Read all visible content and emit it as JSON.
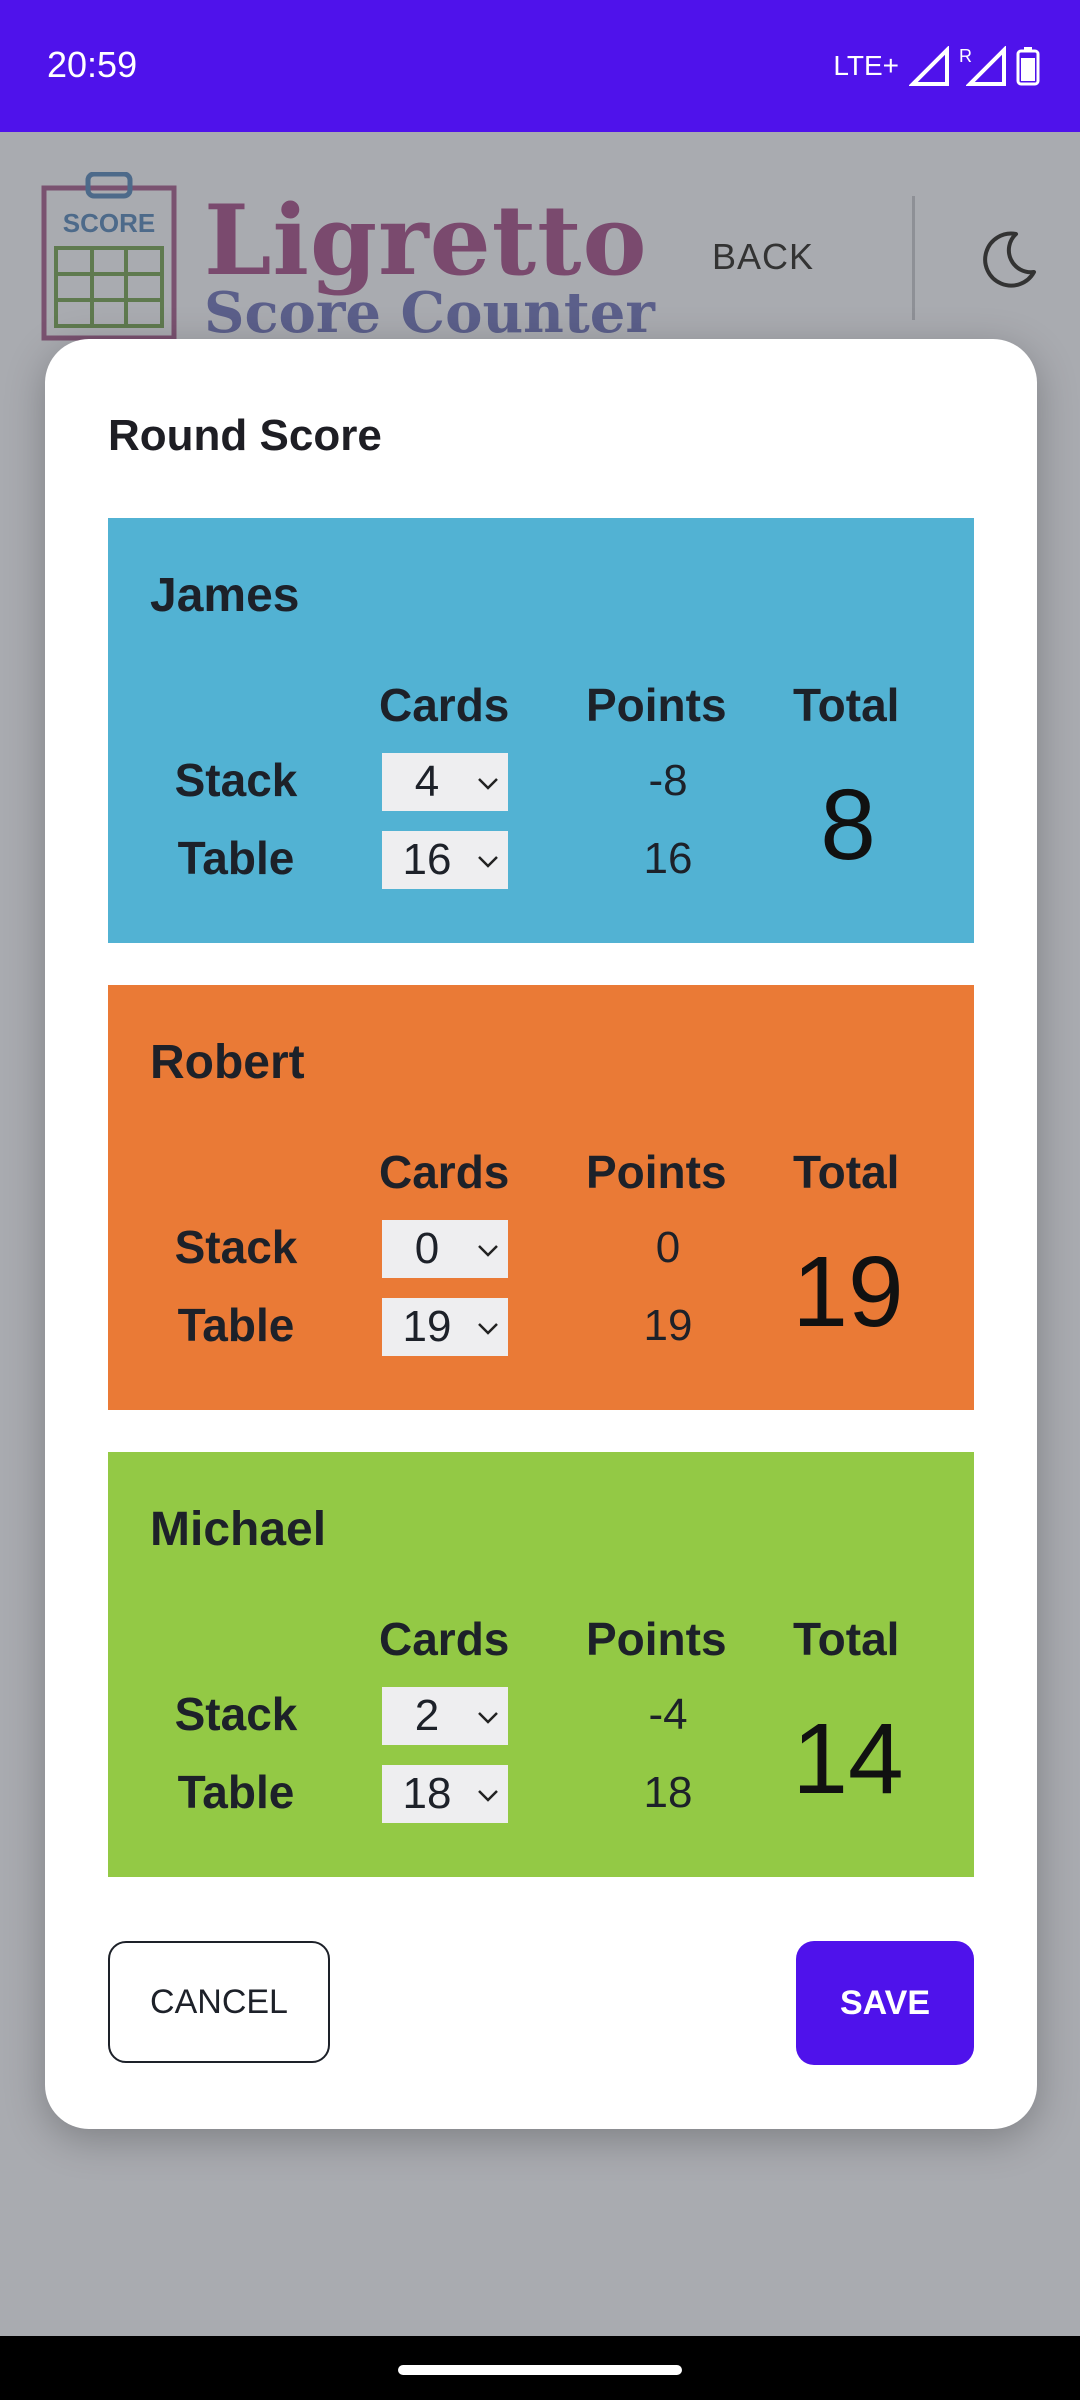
{
  "status_bar": {
    "time": "20:59",
    "network": "LTE+",
    "roaming": "R"
  },
  "header": {
    "logo_badge": "SCORE",
    "logo_title": "Ligretto",
    "logo_subtitle": "Score Counter",
    "back_label": "BACK"
  },
  "dialog": {
    "title": "Round Score",
    "column_headers": {
      "cards": "Cards",
      "points": "Points",
      "total": "Total"
    },
    "row_labels": {
      "stack": "Stack",
      "table": "Table"
    },
    "players": [
      {
        "name": "James",
        "color": "#52b2d3",
        "stack_cards": "4",
        "table_cards": "16",
        "stack_points": "-8",
        "table_points": "16",
        "total": "8"
      },
      {
        "name": "Robert",
        "color": "#ea7a36",
        "stack_cards": "0",
        "table_cards": "19",
        "stack_points": "0",
        "table_points": "19",
        "total": "19"
      },
      {
        "name": "Michael",
        "color": "#93c945",
        "stack_cards": "2",
        "table_cards": "18",
        "stack_points": "-4",
        "table_points": "18",
        "total": "14"
      }
    ],
    "cancel_label": "CANCEL",
    "save_label": "SAVE"
  },
  "colors": {
    "accent": "#4f12eb"
  }
}
